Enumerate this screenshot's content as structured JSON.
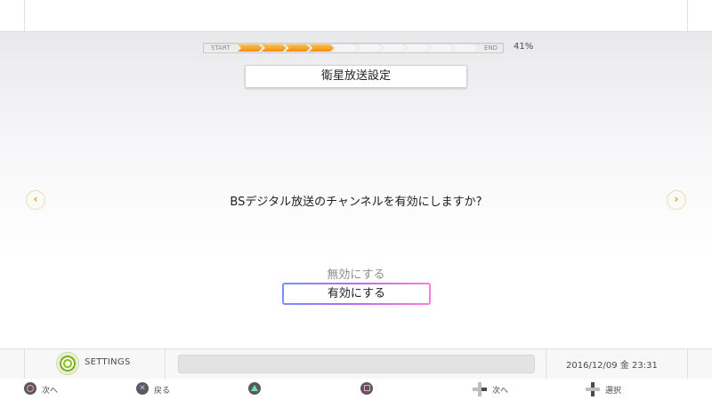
{
  "progress": {
    "start_label": "START",
    "end_label": "END",
    "percent_text": "41%",
    "value": 0.41,
    "total_segments": 10,
    "filled_segments": 4,
    "fill_color": "#f5a623"
  },
  "title": "衛星放送設定",
  "question": "BSデジタル放送のチャンネルを有効にしますか?",
  "options": {
    "disabled_label": "無効にする",
    "selected_label": "有効にする"
  },
  "status_bar": {
    "app_label": "SETTINGS",
    "app_icon": "settings-gear-icon",
    "datetime": "2016/12/09 金 23:31"
  },
  "button_hints": [
    {
      "button": "circle",
      "label": "次へ"
    },
    {
      "button": "cross",
      "label": "戻る"
    },
    {
      "button": "triangle",
      "label": ""
    },
    {
      "button": "square",
      "label": ""
    },
    {
      "button": "dpad-right",
      "label": "次へ"
    },
    {
      "button": "dpad-vertical",
      "label": "選択"
    }
  ],
  "colors": {
    "accent_orange": "#f5a623",
    "selection_gradient_start": "#7b8cff",
    "selection_gradient_end": "#ff7cd6",
    "nav_arrow": "#d4a21e"
  }
}
